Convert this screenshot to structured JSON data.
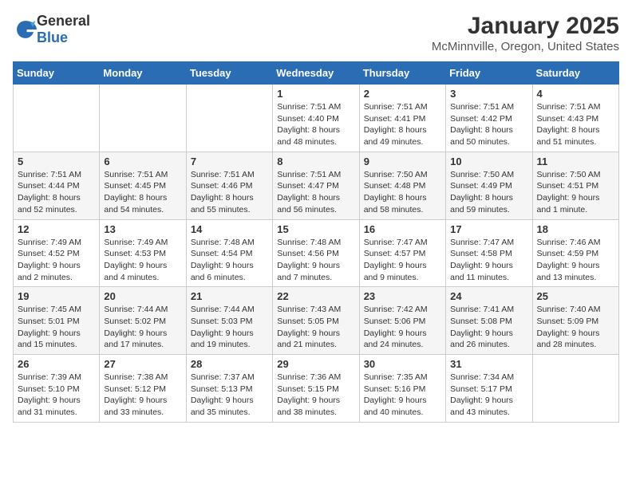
{
  "logo": {
    "text_general": "General",
    "text_blue": "Blue"
  },
  "title": "January 2025",
  "location": "McMinnville, Oregon, United States",
  "days_of_week": [
    "Sunday",
    "Monday",
    "Tuesday",
    "Wednesday",
    "Thursday",
    "Friday",
    "Saturday"
  ],
  "weeks": [
    [
      {
        "day": "",
        "sunrise": "",
        "sunset": "",
        "daylight": ""
      },
      {
        "day": "",
        "sunrise": "",
        "sunset": "",
        "daylight": ""
      },
      {
        "day": "",
        "sunrise": "",
        "sunset": "",
        "daylight": ""
      },
      {
        "day": "1",
        "sunrise": "Sunrise: 7:51 AM",
        "sunset": "Sunset: 4:40 PM",
        "daylight": "Daylight: 8 hours and 48 minutes."
      },
      {
        "day": "2",
        "sunrise": "Sunrise: 7:51 AM",
        "sunset": "Sunset: 4:41 PM",
        "daylight": "Daylight: 8 hours and 49 minutes."
      },
      {
        "day": "3",
        "sunrise": "Sunrise: 7:51 AM",
        "sunset": "Sunset: 4:42 PM",
        "daylight": "Daylight: 8 hours and 50 minutes."
      },
      {
        "day": "4",
        "sunrise": "Sunrise: 7:51 AM",
        "sunset": "Sunset: 4:43 PM",
        "daylight": "Daylight: 8 hours and 51 minutes."
      }
    ],
    [
      {
        "day": "5",
        "sunrise": "Sunrise: 7:51 AM",
        "sunset": "Sunset: 4:44 PM",
        "daylight": "Daylight: 8 hours and 52 minutes."
      },
      {
        "day": "6",
        "sunrise": "Sunrise: 7:51 AM",
        "sunset": "Sunset: 4:45 PM",
        "daylight": "Daylight: 8 hours and 54 minutes."
      },
      {
        "day": "7",
        "sunrise": "Sunrise: 7:51 AM",
        "sunset": "Sunset: 4:46 PM",
        "daylight": "Daylight: 8 hours and 55 minutes."
      },
      {
        "day": "8",
        "sunrise": "Sunrise: 7:51 AM",
        "sunset": "Sunset: 4:47 PM",
        "daylight": "Daylight: 8 hours and 56 minutes."
      },
      {
        "day": "9",
        "sunrise": "Sunrise: 7:50 AM",
        "sunset": "Sunset: 4:48 PM",
        "daylight": "Daylight: 8 hours and 58 minutes."
      },
      {
        "day": "10",
        "sunrise": "Sunrise: 7:50 AM",
        "sunset": "Sunset: 4:49 PM",
        "daylight": "Daylight: 8 hours and 59 minutes."
      },
      {
        "day": "11",
        "sunrise": "Sunrise: 7:50 AM",
        "sunset": "Sunset: 4:51 PM",
        "daylight": "Daylight: 9 hours and 1 minute."
      }
    ],
    [
      {
        "day": "12",
        "sunrise": "Sunrise: 7:49 AM",
        "sunset": "Sunset: 4:52 PM",
        "daylight": "Daylight: 9 hours and 2 minutes."
      },
      {
        "day": "13",
        "sunrise": "Sunrise: 7:49 AM",
        "sunset": "Sunset: 4:53 PM",
        "daylight": "Daylight: 9 hours and 4 minutes."
      },
      {
        "day": "14",
        "sunrise": "Sunrise: 7:48 AM",
        "sunset": "Sunset: 4:54 PM",
        "daylight": "Daylight: 9 hours and 6 minutes."
      },
      {
        "day": "15",
        "sunrise": "Sunrise: 7:48 AM",
        "sunset": "Sunset: 4:56 PM",
        "daylight": "Daylight: 9 hours and 7 minutes."
      },
      {
        "day": "16",
        "sunrise": "Sunrise: 7:47 AM",
        "sunset": "Sunset: 4:57 PM",
        "daylight": "Daylight: 9 hours and 9 minutes."
      },
      {
        "day": "17",
        "sunrise": "Sunrise: 7:47 AM",
        "sunset": "Sunset: 4:58 PM",
        "daylight": "Daylight: 9 hours and 11 minutes."
      },
      {
        "day": "18",
        "sunrise": "Sunrise: 7:46 AM",
        "sunset": "Sunset: 4:59 PM",
        "daylight": "Daylight: 9 hours and 13 minutes."
      }
    ],
    [
      {
        "day": "19",
        "sunrise": "Sunrise: 7:45 AM",
        "sunset": "Sunset: 5:01 PM",
        "daylight": "Daylight: 9 hours and 15 minutes."
      },
      {
        "day": "20",
        "sunrise": "Sunrise: 7:44 AM",
        "sunset": "Sunset: 5:02 PM",
        "daylight": "Daylight: 9 hours and 17 minutes."
      },
      {
        "day": "21",
        "sunrise": "Sunrise: 7:44 AM",
        "sunset": "Sunset: 5:03 PM",
        "daylight": "Daylight: 9 hours and 19 minutes."
      },
      {
        "day": "22",
        "sunrise": "Sunrise: 7:43 AM",
        "sunset": "Sunset: 5:05 PM",
        "daylight": "Daylight: 9 hours and 21 minutes."
      },
      {
        "day": "23",
        "sunrise": "Sunrise: 7:42 AM",
        "sunset": "Sunset: 5:06 PM",
        "daylight": "Daylight: 9 hours and 24 minutes."
      },
      {
        "day": "24",
        "sunrise": "Sunrise: 7:41 AM",
        "sunset": "Sunset: 5:08 PM",
        "daylight": "Daylight: 9 hours and 26 minutes."
      },
      {
        "day": "25",
        "sunrise": "Sunrise: 7:40 AM",
        "sunset": "Sunset: 5:09 PM",
        "daylight": "Daylight: 9 hours and 28 minutes."
      }
    ],
    [
      {
        "day": "26",
        "sunrise": "Sunrise: 7:39 AM",
        "sunset": "Sunset: 5:10 PM",
        "daylight": "Daylight: 9 hours and 31 minutes."
      },
      {
        "day": "27",
        "sunrise": "Sunrise: 7:38 AM",
        "sunset": "Sunset: 5:12 PM",
        "daylight": "Daylight: 9 hours and 33 minutes."
      },
      {
        "day": "28",
        "sunrise": "Sunrise: 7:37 AM",
        "sunset": "Sunset: 5:13 PM",
        "daylight": "Daylight: 9 hours and 35 minutes."
      },
      {
        "day": "29",
        "sunrise": "Sunrise: 7:36 AM",
        "sunset": "Sunset: 5:15 PM",
        "daylight": "Daylight: 9 hours and 38 minutes."
      },
      {
        "day": "30",
        "sunrise": "Sunrise: 7:35 AM",
        "sunset": "Sunset: 5:16 PM",
        "daylight": "Daylight: 9 hours and 40 minutes."
      },
      {
        "day": "31",
        "sunrise": "Sunrise: 7:34 AM",
        "sunset": "Sunset: 5:17 PM",
        "daylight": "Daylight: 9 hours and 43 minutes."
      },
      {
        "day": "",
        "sunrise": "",
        "sunset": "",
        "daylight": ""
      }
    ]
  ]
}
